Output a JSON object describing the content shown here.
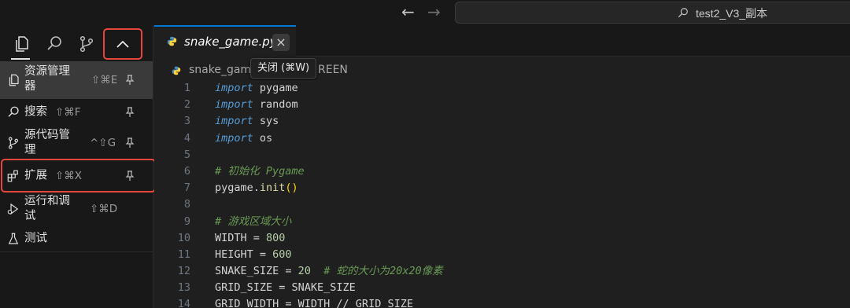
{
  "titlebar": {
    "back_icon": "arrow-left",
    "forward_icon": "arrow-right",
    "command_center_text": "test2_V3_副本"
  },
  "activity": {
    "icons": [
      "files-icon",
      "search-icon",
      "source-control-icon",
      "chevron-up-icon"
    ]
  },
  "menu": {
    "items": [
      {
        "label": "资源管理器",
        "shortcut": "⇧⌘E",
        "icon": "files-icon"
      },
      {
        "label": "搜索",
        "shortcut": "⇧⌘F",
        "icon": "search-icon"
      },
      {
        "label": "源代码管理",
        "shortcut": "^⇧G",
        "icon": "source-control-icon"
      },
      {
        "label": "扩展",
        "shortcut": "⇧⌘X",
        "icon": "extensions-icon"
      },
      {
        "label": "运行和调试",
        "shortcut": "⇧⌘D",
        "icon": "run-debug-icon"
      },
      {
        "label": "测试",
        "shortcut": "",
        "icon": "testing-icon"
      }
    ]
  },
  "editor": {
    "tab_label": "snake_game.py",
    "tab_close": "×",
    "breadcrumb_file": "snake_gam",
    "breadcrumb_rest": "REEN",
    "tooltip": "关闭 (⌘W)"
  },
  "code": {
    "line_numbers": [
      "1",
      "2",
      "3",
      "4",
      "5",
      "6",
      "7",
      "8",
      "9",
      "10",
      "11",
      "12",
      "13",
      "14"
    ],
    "lines": [
      [
        {
          "t": "import",
          "c": "kw"
        },
        {
          "t": " pygame",
          "c": ""
        }
      ],
      [
        {
          "t": "import",
          "c": "kw"
        },
        {
          "t": " random",
          "c": ""
        }
      ],
      [
        {
          "t": "import",
          "c": "kw"
        },
        {
          "t": " sys",
          "c": ""
        }
      ],
      [
        {
          "t": "import",
          "c": "kw"
        },
        {
          "t": " os",
          "c": ""
        }
      ],
      [],
      [
        {
          "t": "# 初始化 Pygame",
          "c": "cm"
        }
      ],
      [
        {
          "t": "pygame.",
          "c": ""
        },
        {
          "t": "init",
          "c": "fn"
        },
        {
          "t": "()",
          "c": "paren"
        }
      ],
      [],
      [
        {
          "t": "# 游戏区域大小",
          "c": "cm"
        }
      ],
      [
        {
          "t": "WIDTH = ",
          "c": ""
        },
        {
          "t": "800",
          "c": "num"
        }
      ],
      [
        {
          "t": "HEIGHT = ",
          "c": ""
        },
        {
          "t": "600",
          "c": "num"
        }
      ],
      [
        {
          "t": "SNAKE_SIZE = ",
          "c": ""
        },
        {
          "t": "20",
          "c": "num"
        },
        {
          "t": "  ",
          "c": ""
        },
        {
          "t": "# 蛇的大小为20x20像素",
          "c": "cm"
        }
      ],
      [
        {
          "t": "GRID_SIZE = SNAKE_SIZE",
          "c": ""
        }
      ],
      [
        {
          "t": "GRID_WIDTH = WIDTH // GRID_SIZE",
          "c": ""
        }
      ]
    ]
  }
}
